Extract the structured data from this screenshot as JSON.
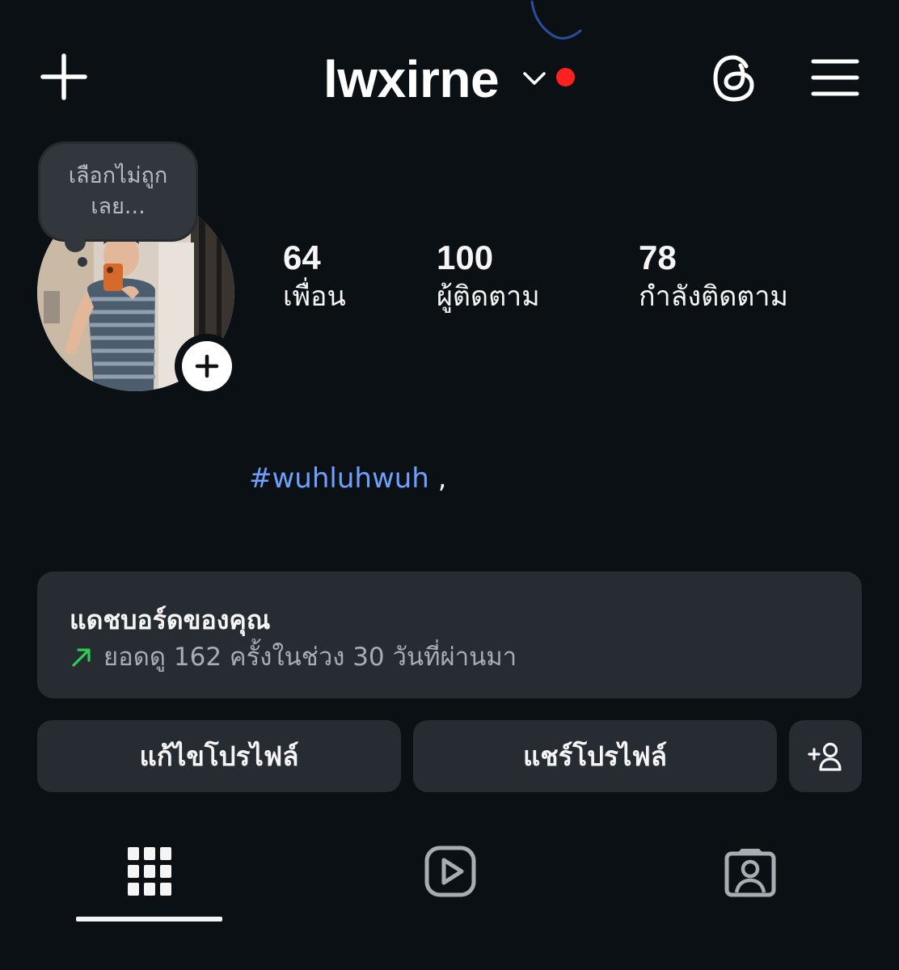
{
  "header": {
    "username": "lwxirne",
    "notification_dot_color": "#ff2020",
    "icons": {
      "create": "plus-icon",
      "switch_account": "chevron-down-icon",
      "threads": "threads-icon",
      "menu": "hamburger-menu-icon"
    }
  },
  "profile": {
    "note": "เลือกไม่ถูก เลย...",
    "avatar_add_icon": "plus-icon",
    "stats": [
      {
        "value": "64",
        "label": "เพื่อน"
      },
      {
        "value": "100",
        "label": "ผู้ติดตาม"
      },
      {
        "value": "78",
        "label": "กำลังติดตาม"
      }
    ],
    "bio": {
      "hashtag": "#wuhluhwuh",
      "suffix": " ,"
    }
  },
  "dashboard": {
    "title": "แดชบอร์ดของคุณ",
    "subtitle": "ยอดดู 162 ครั้งในช่วง 30 วันที่ผ่านมา",
    "trend_icon": "trend-up-arrow-icon",
    "trend_color": "#2ecc55"
  },
  "actions": {
    "edit_profile": "แก้ไขโปรไฟล์",
    "share_profile": "แชร์โปรไฟล์",
    "discover_people_icon": "add-person-icon"
  },
  "tabs": [
    {
      "name": "posts",
      "icon": "grid-icon",
      "active": true
    },
    {
      "name": "reels",
      "icon": "reels-play-icon",
      "active": false
    },
    {
      "name": "tagged",
      "icon": "tagged-person-icon",
      "active": false
    }
  ]
}
